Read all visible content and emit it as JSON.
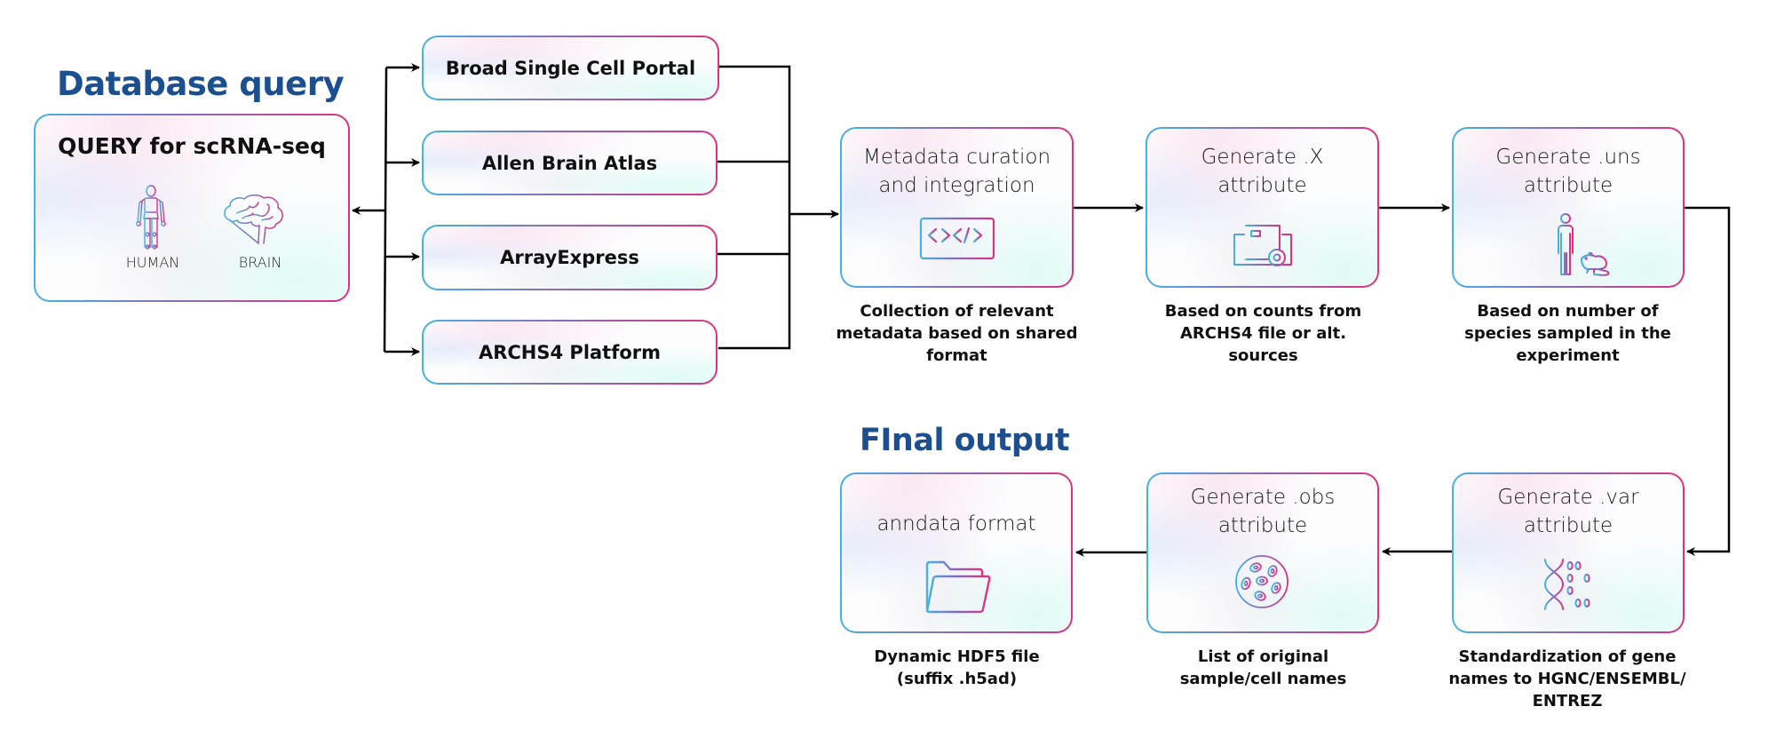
{
  "sections": {
    "database_query_title": "Database query",
    "final_output_title": "FInal output"
  },
  "query_box": {
    "title": "QUERY for scRNA-seq",
    "items": [
      {
        "icon": "human-skeleton-icon",
        "label": "HUMAN"
      },
      {
        "icon": "brain-icon",
        "label": "BRAIN"
      }
    ]
  },
  "sources": [
    {
      "label": "Broad Single Cell Portal"
    },
    {
      "label": "Allen Brain Atlas"
    },
    {
      "label": "ArrayExpress"
    },
    {
      "label": "ARCHS4 Platform"
    }
  ],
  "stages": {
    "metadata": {
      "title_lines": [
        "Metadata curation",
        "and integration"
      ],
      "icon": "code-monitor-icon",
      "caption_lines": [
        "Collection of relevant",
        "metadata based on shared",
        "format"
      ]
    },
    "x": {
      "title_lines": [
        "Generate .X",
        "attribute"
      ],
      "icon": "document-gear-monitor-icon",
      "caption_lines": [
        "Based on counts from",
        "ARCHS4 file or alt.",
        "sources"
      ]
    },
    "uns": {
      "title_lines": [
        "Generate .uns",
        "attribute"
      ],
      "icon": "human-mouse-icon",
      "caption_lines": [
        "Based on number of",
        "species sampled in the",
        "experiment"
      ]
    },
    "var": {
      "title_lines": [
        "Generate .var",
        "attribute"
      ],
      "icon": "dna-binary-icon",
      "caption_lines": [
        "Standardization of gene",
        "names to HGNC/ENSEMBL/",
        "ENTREZ"
      ]
    },
    "obs": {
      "title_lines": [
        "Generate .obs",
        "attribute"
      ],
      "icon": "cells-icon",
      "caption_lines": [
        "List of original",
        "sample/cell names"
      ]
    },
    "anndata": {
      "title_lines": [
        "anndata format"
      ],
      "icon": "folder-open-icon",
      "caption_lines": [
        "Dynamic HDF5 file",
        "(suffix .h5ad)"
      ]
    }
  },
  "colors": {
    "title_blue": "#1c4f8f",
    "gradient_start": "#45b3e3",
    "gradient_mid": "#8c68b8",
    "gradient_end": "#e0327e",
    "connector": "#000000"
  }
}
